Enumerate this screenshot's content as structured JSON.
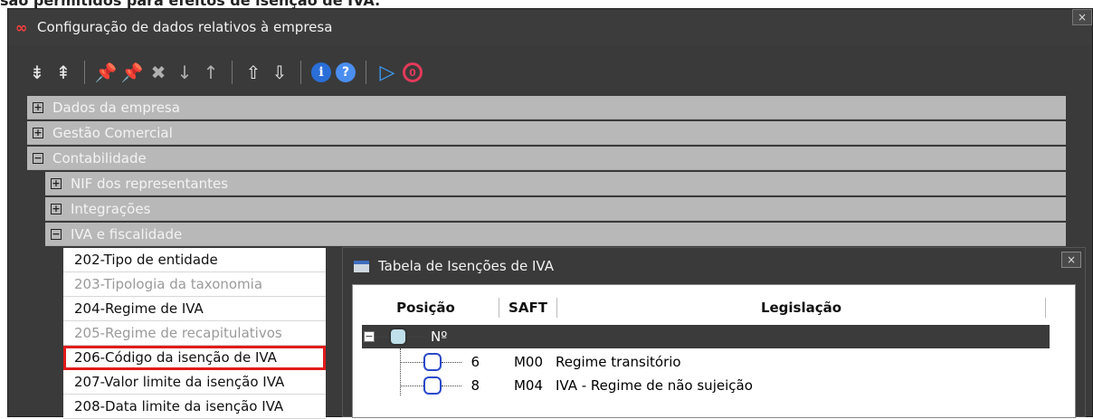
{
  "top_text": "são permitidos para efeitos de isenção de IVA.",
  "window": {
    "title": "Configuração de dados relativos à empresa",
    "close_label": "×"
  },
  "toolbar": [
    {
      "name": "expand-all-icon",
      "glyph": "⇟"
    },
    {
      "name": "collapse-all-icon",
      "glyph": "⇞"
    },
    {
      "name": "pin-add-icon",
      "glyph": "📌"
    },
    {
      "name": "pin-icon",
      "glyph": "📌"
    },
    {
      "name": "pin-remove-icon",
      "glyph": "✖"
    },
    {
      "name": "arrow-down-icon",
      "glyph": "↓"
    },
    {
      "name": "arrow-up-icon",
      "glyph": "↑"
    },
    {
      "name": "export-icon",
      "glyph": "⇧"
    },
    {
      "name": "import-icon",
      "glyph": "⇩"
    },
    {
      "name": "info-icon",
      "glyph": "i"
    },
    {
      "name": "help-icon",
      "glyph": "?"
    },
    {
      "name": "play-icon",
      "glyph": "▷"
    },
    {
      "name": "power-icon",
      "glyph": "0"
    }
  ],
  "tree": {
    "level0": [
      {
        "label": "Dados da empresa",
        "exp": "+"
      },
      {
        "label": "Gestão Comercial",
        "exp": "+"
      },
      {
        "label": "Contabilidade",
        "exp": "−"
      }
    ],
    "level1": [
      {
        "label": "NIF dos representantes",
        "exp": "+"
      },
      {
        "label": "Integrações",
        "exp": "+"
      },
      {
        "label": "IVA e fiscalidade",
        "exp": "−"
      }
    ],
    "items": [
      {
        "label": "202-Tipo de entidade"
      },
      {
        "label": "203-Tipologia da taxonomia"
      },
      {
        "label": "204-Regime de IVA"
      },
      {
        "label": "205-Regime de recapitulativos"
      },
      {
        "label": "206-Código da isenção de IVA"
      },
      {
        "label": "207-Valor limite da isenção IVA"
      },
      {
        "label": "208-Data limite da isenção IVA"
      }
    ]
  },
  "dialog": {
    "title": "Tabela de Isenções de IVA",
    "close_label": "×",
    "columns": [
      "Posição",
      "SAFT",
      "Legislação"
    ],
    "group_label": "Nº",
    "group_toggle": "−",
    "rows": [
      {
        "pos": "6",
        "saft": "M00",
        "leg": "Regime transitório"
      },
      {
        "pos": "8",
        "saft": "M04",
        "leg": "IVA - Regime de não sujeição"
      }
    ]
  }
}
